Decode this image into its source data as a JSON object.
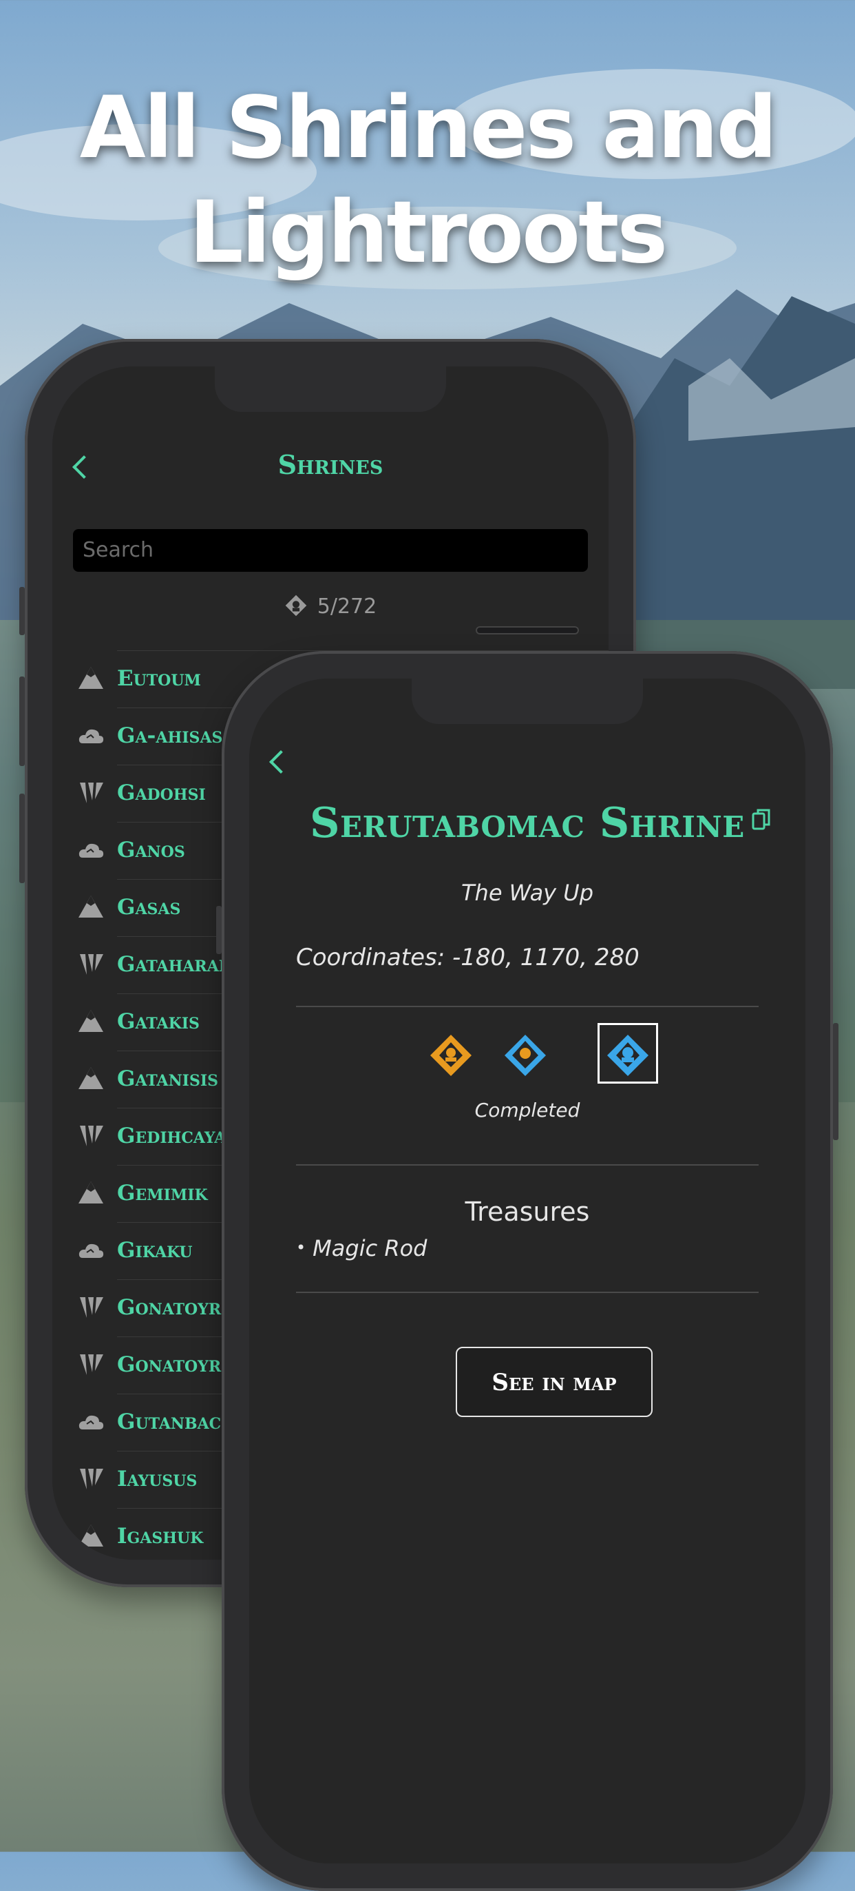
{
  "headline": {
    "line1": "All Shrines and",
    "line2": "Lightroots"
  },
  "back_screen": {
    "title": "Shrines",
    "search_placeholder": "Search",
    "counter": "5/272",
    "rows": [
      {
        "name": "Eutoum",
        "region_icon": "mountain-icon"
      },
      {
        "name": "Ga-ahisas",
        "region_icon": "cloud-icon"
      },
      {
        "name": "Gadohsi",
        "region_icon": "claw-icon"
      },
      {
        "name": "Ganos",
        "region_icon": "cloud-icon"
      },
      {
        "name": "Gasas",
        "region_icon": "mountain-icon"
      },
      {
        "name": "Gataharak",
        "region_icon": "claw-icon"
      },
      {
        "name": "Gatakis",
        "region_icon": "mountain-icon"
      },
      {
        "name": "Gatanisis",
        "region_icon": "mountain-icon"
      },
      {
        "name": "Gedihcayan",
        "region_icon": "claw-icon"
      },
      {
        "name": "Gemimik",
        "region_icon": "mountain-icon"
      },
      {
        "name": "Gikaku",
        "region_icon": "cloud-icon"
      },
      {
        "name": "Gonatoyrin",
        "region_icon": "claw-icon"
      },
      {
        "name": "Gonatoyro",
        "region_icon": "claw-icon"
      },
      {
        "name": "Gutanbac",
        "region_icon": "cloud-icon"
      },
      {
        "name": "Iayusus",
        "region_icon": "claw-icon"
      },
      {
        "name": "Igashuk",
        "region_icon": "mountain-icon"
      }
    ]
  },
  "detail": {
    "title": "Serutabomac Shrine",
    "subtitle": "The Way Up",
    "coordinates": "Coordinates: -180, 1170, 280",
    "status_label": "Completed",
    "treasures_heading": "Treasures",
    "treasures": [
      "Magic Rod"
    ],
    "map_button": "See in map"
  },
  "colors": {
    "accent": "#4fd5a6",
    "shrine_orange": "#e89a1f",
    "shrine_blue": "#3aa6e8",
    "screen_bg": "#262626"
  }
}
